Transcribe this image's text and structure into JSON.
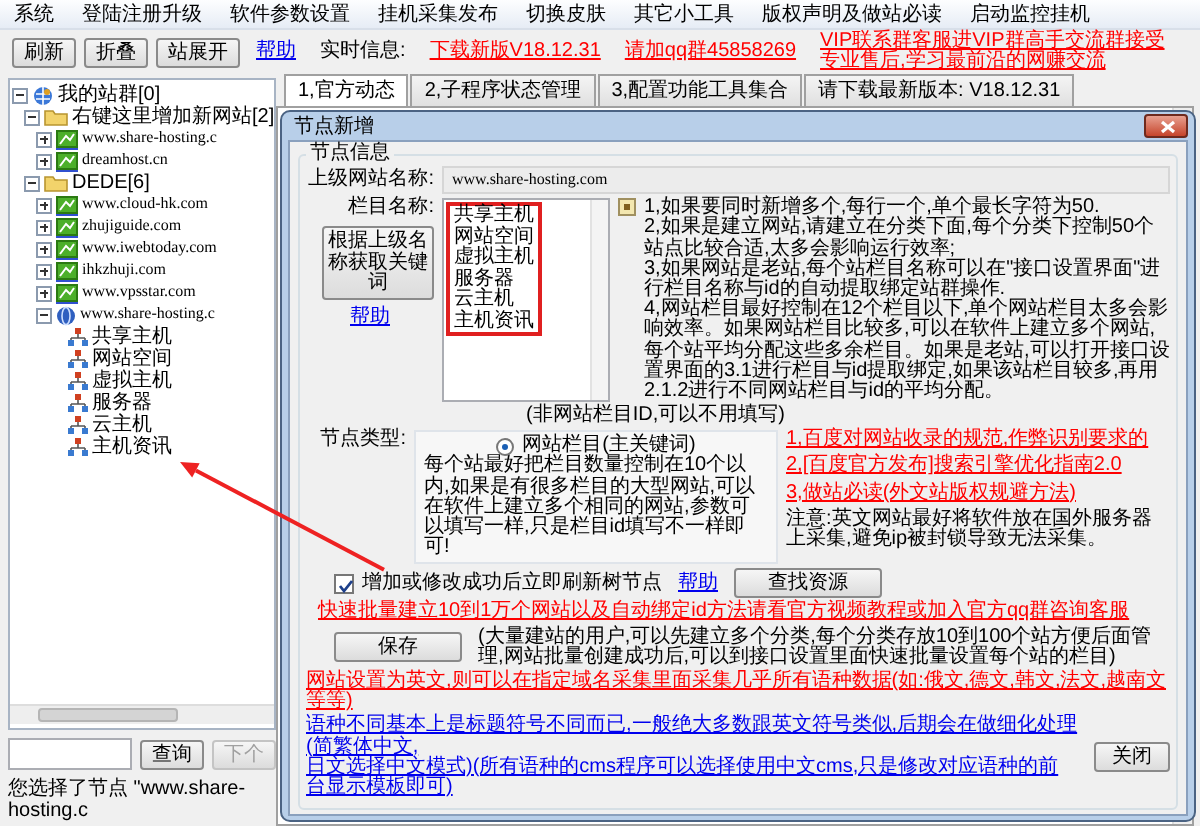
{
  "menu": [
    "系统",
    "登陆注册升级",
    "软件参数设置",
    "挂机采集发布",
    "切换皮肤",
    "其它小工具",
    "版权声明及做站必读",
    "启动监控挂机"
  ],
  "toolbar": {
    "buttons": [
      "刷新",
      "折叠",
      "站展开"
    ],
    "help_link": "帮助",
    "info_label": "实时信息:",
    "info_links": [
      "下载新版V18.12.31",
      "请加qq群45858269",
      "VIP联系群客服进VIP群高手交流群接受专业售后,学习最前沿的网赚交流"
    ]
  },
  "sidebar": {
    "tree": [
      {
        "label": "我的站群[0]",
        "kind": "root",
        "expanded": true,
        "children": [
          {
            "label": "右键这里增加新网站[2]",
            "kind": "folder",
            "expanded": true,
            "children": [
              {
                "label": "www.share-hosting.c",
                "kind": "site",
                "expanded": false
              },
              {
                "label": "dreamhost.cn",
                "kind": "site",
                "expanded": false
              }
            ]
          },
          {
            "label": "DEDE[6]",
            "kind": "folder",
            "expanded": true,
            "children": [
              {
                "label": "www.cloud-hk.com",
                "kind": "site",
                "expanded": false
              },
              {
                "label": "zhujiguide.com",
                "kind": "site",
                "expanded": false
              },
              {
                "label": "www.iwebtoday.com",
                "kind": "site",
                "expanded": false
              },
              {
                "label": "ihkzhuji.com",
                "kind": "site",
                "expanded": false
              },
              {
                "label": "www.vpsstar.com",
                "kind": "site",
                "expanded": false
              },
              {
                "label": "www.share-hosting.c",
                "kind": "site",
                "expanded": true,
                "children": [
                  {
                    "label": "共享主机",
                    "kind": "category"
                  },
                  {
                    "label": "网站空间",
                    "kind": "category"
                  },
                  {
                    "label": "虚拟主机",
                    "kind": "category"
                  },
                  {
                    "label": "服务器",
                    "kind": "category"
                  },
                  {
                    "label": "云主机",
                    "kind": "category"
                  },
                  {
                    "label": "主机资讯",
                    "kind": "category"
                  }
                ]
              }
            ]
          }
        ]
      }
    ],
    "search_button": "查询",
    "next_button": {
      "label": "下个",
      "disabled": true
    },
    "status": "您选择了节点 \"www.share-hosting.c"
  },
  "tabs": [
    {
      "label": "1,官方动态",
      "selected": true
    },
    {
      "label": "2,子程序状态管理",
      "selected": false
    },
    {
      "label": "3,配置功能工具集合",
      "selected": false
    },
    {
      "label": "请下载最新版本: V18.12.31",
      "selected": false
    }
  ],
  "dialog": {
    "title": "节点新增",
    "group_title": "节点信息",
    "parent_site": {
      "label": "上级网站名称:",
      "value": "www.share-hosting.com"
    },
    "column_names": {
      "label": "栏目名称:",
      "lines": [
        "共享主机",
        "网站空间",
        "虚拟主机",
        "服务器",
        "云主机",
        "主机资讯"
      ],
      "highlighted": true
    },
    "keyword_button": "根据上级名称获取关键词",
    "help_link": "帮助",
    "notes": [
      "1,如果要同时新增多个,每行一个,单个最长字符为50.",
      "2,如果是建立网站,请建立在分类下面,每个分类下控制50个站点比较合适,太多会影响运行效率;",
      "3,如果网站是老站,每个站栏目名称可以在\"接口设置界面\"进行栏目名称与id的自动提取绑定站群操作.",
      "4,网站栏目最好控制在12个栏目以下,单个网站栏目太多会影响效率。如果网站栏目比较多,可以在软件上建立多个网站,每个站平均分配这些多余栏目。如果是老站,可以打开接口设置界面的3.1进行栏目与id提取绑定,如果该站栏目较多,再用2.1.2进行不同网站栏目与id的平均分配。"
    ],
    "hint": "(非网站栏目ID,可以不用填写)",
    "node_type": {
      "label": "节点类型:",
      "options": [
        {
          "label": "网站栏目(主关键词)",
          "selected": true
        }
      ],
      "description": "每个站最好把栏目数量控制在10个以内,如果是有很多栏目的大型网站,可以在软件上建立多个相同的网站,参数可以填写一样,只是栏目id填写不一样即可!"
    },
    "side_links": [
      "1,百度对网站收录的规范,作弊识别要求的",
      "2,[百度官方发布]搜索引擎优化指南2.0",
      "3,做站必读(外文站版权规避方法)"
    ],
    "notice": "注意:英文网站最好将软件放在国外服务器上采集,避免ip被封锁导致无法采集。",
    "refresh_checkbox": {
      "label": "增加或修改成功后立即刷新树节点",
      "checked": true
    },
    "refresh_help_link": "帮助",
    "find_button": "查找资源",
    "batch_link": "快速批量建立10到1万个网站以及自动绑定id方法请看官方视频教程或加入官方qq群咨询客服",
    "save_button": "保存",
    "save_note": "(大量建站的用户,可以先建立多个分类,每个分类存放10到100个站方便后面管理,网站批量创建成功后,可以到接口设置里面快速批量设置每个站的栏目)",
    "language_link": "网站设置为英文,则可以在指定域名采集里面采集几乎所有语种数据(如:俄文,德文,韩文,法文,越南文等等)",
    "language_notes": [
      "语种不同基本上是标题符号不同而已,一般绝大多数跟英文符号类似,后期会在做细化处理(简繁体中文,",
      "日文选择中文模式)(所有语种的cms程序可以选择使用中文cms,只是修改对应语种的前台显示模板即可)"
    ],
    "close_button": "关闭"
  }
}
